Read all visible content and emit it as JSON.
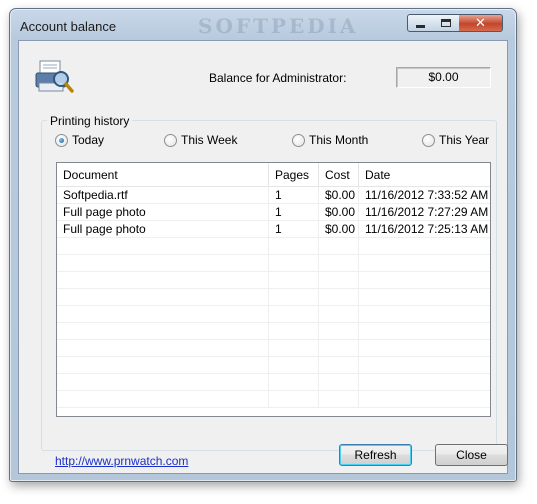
{
  "window": {
    "title": "Account balance",
    "watermark": "SOFTPEDIA"
  },
  "title_controls": {
    "minimize_icon": "minimize-icon",
    "maximize_icon": "maximize-icon",
    "close_glyph": "✕"
  },
  "header": {
    "icon": "printer-magnifier-icon",
    "balance_label": "Balance for Administrator:",
    "balance_value": "$0.00"
  },
  "printing_history": {
    "group_title": "Printing history",
    "periods": [
      {
        "label": "Today",
        "checked": true
      },
      {
        "label": "This Week",
        "checked": false
      },
      {
        "label": "This Month",
        "checked": false
      },
      {
        "label": "This Year",
        "checked": false
      }
    ],
    "columns": [
      "Document",
      "Pages",
      "Cost",
      "Date"
    ],
    "rows": [
      [
        "Softpedia.rtf",
        "1",
        "$0.00",
        "11/16/2012 7:33:52 AM"
      ],
      [
        "Full page photo",
        "1",
        "$0.00",
        "11/16/2012 7:27:29 AM"
      ],
      [
        "Full page photo",
        "1",
        "$0.00",
        "11/16/2012 7:25:13 AM"
      ]
    ]
  },
  "footer": {
    "link": "http://www.prnwatch.com",
    "refresh_label": "Refresh",
    "close_label": "Close"
  },
  "colors": {
    "link": "#1a2fc9",
    "titlebar": "#b8cade",
    "close_button": "#c2462a"
  }
}
